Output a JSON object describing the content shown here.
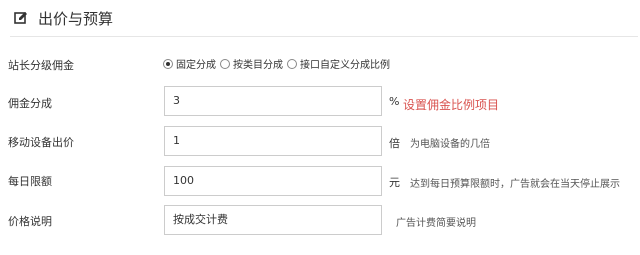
{
  "section": {
    "title": "出价与预算",
    "icon": "edit-icon"
  },
  "commission_level": {
    "label": "站长分级佣金",
    "options": [
      {
        "label": "固定分成",
        "checked": true
      },
      {
        "label": "按类目分成",
        "checked": false
      },
      {
        "label": "接口自定义分成比例",
        "checked": false
      }
    ]
  },
  "commission_share": {
    "label": "佣金分成",
    "value": "3",
    "unit": "%",
    "link": "设置佣金比例项目"
  },
  "mobile_bid": {
    "label": "移动设备出价",
    "value": "1",
    "unit": "倍",
    "hint": "为电脑设备的几倍"
  },
  "daily_limit": {
    "label": "每日限额",
    "value": "100",
    "unit": "元",
    "hint": "达到每日预算限额时，广告就会在当天停止展示"
  },
  "price_note": {
    "label": "价格说明",
    "value": "按成交计费",
    "hint": "广告计费简要说明"
  }
}
